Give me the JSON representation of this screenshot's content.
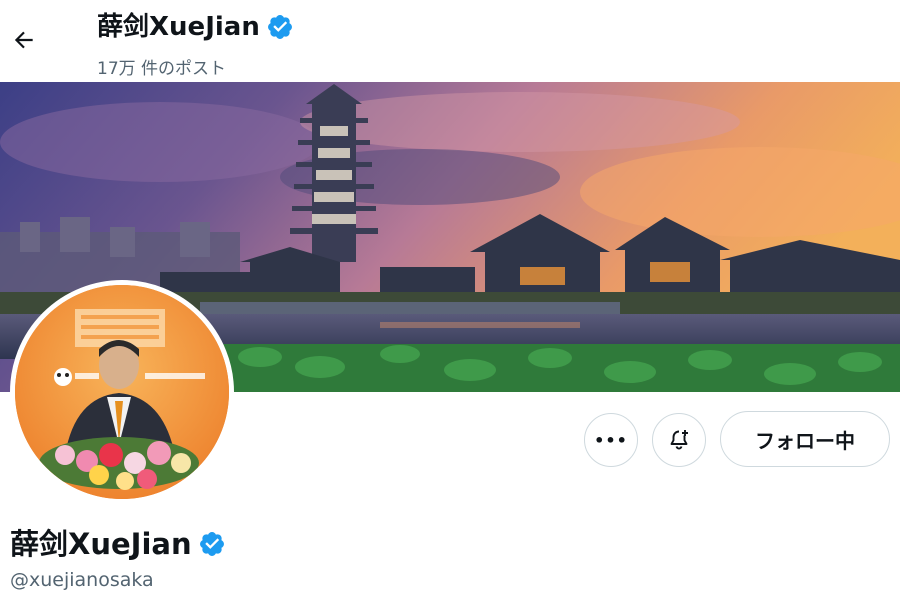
{
  "header": {
    "title": "薛剑XueJian",
    "post_count": "17万 件のポスト"
  },
  "profile": {
    "display_name": "薛剑XueJian",
    "handle": "@xuejianosaka",
    "verified": true
  },
  "actions": {
    "more_label": "•••",
    "notify_icon": "bell-plus-icon",
    "follow_label": "フォロー中"
  },
  "colors": {
    "verified_blue": "#1d9bf0",
    "secondary_text": "#536471",
    "border": "#cfd9de"
  }
}
